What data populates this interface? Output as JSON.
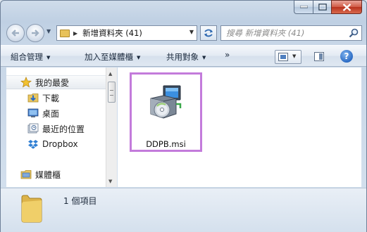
{
  "window": {
    "caption_buttons": [
      "minimize",
      "maximize",
      "close"
    ]
  },
  "address": {
    "path": "新增資料夾 (41)"
  },
  "search": {
    "placeholder": "搜尋 新增資料夾 (41)"
  },
  "command_bar": {
    "organize": "組合管理",
    "include_in_library": "加入至媒體櫃",
    "share_with": "共用對象",
    "more": "»"
  },
  "nav_pane": {
    "favorites": "我的最愛",
    "items": [
      {
        "label": "下載",
        "icon": "download-folder-icon"
      },
      {
        "label": "桌面",
        "icon": "desktop-icon"
      },
      {
        "label": "最近的位置",
        "icon": "recent-places-icon"
      },
      {
        "label": "Dropbox",
        "icon": "dropbox-icon"
      }
    ],
    "libraries": "媒體櫃"
  },
  "content": {
    "files": [
      {
        "name": "DDPB.msi",
        "icon": "msi-installer-icon",
        "selected": true
      }
    ]
  },
  "details": {
    "count_text": "1 個項目"
  },
  "colors": {
    "selection_border": "#c37bdb",
    "close_button": "#c8452e",
    "accent": "#2b6bc4"
  }
}
